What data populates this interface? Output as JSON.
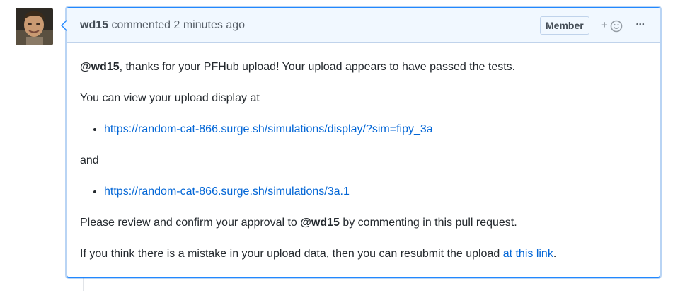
{
  "comment": {
    "author": "wd15",
    "action_text": " commented ",
    "timestamp": "2 minutes ago",
    "badge": "Member",
    "reaction_plus": "+",
    "more_label": "•••"
  },
  "body": {
    "p1_mention": "@wd15",
    "p1_text": ", thanks for your PFHub upload! Your upload appears to have passed the tests.",
    "p2_text": "You can view your upload display at",
    "link1": "https://random-cat-866.surge.sh/simulations/display/?sim=fipy_3a",
    "and_text": "and",
    "link2": "https://random-cat-866.surge.sh/simulations/3a.1",
    "p4_text_before": "Please review and confirm your approval to ",
    "p4_mention": "@wd15",
    "p4_text_after": " by commenting in this pull request.",
    "p5_text": "If you think there is a mistake in your upload data, then you can resubmit the upload ",
    "p5_link": "at this link",
    "p5_end": "."
  },
  "colors": {
    "link": "#0366d6",
    "header_bg": "#f1f8ff",
    "border_focus": "#2188ff"
  }
}
